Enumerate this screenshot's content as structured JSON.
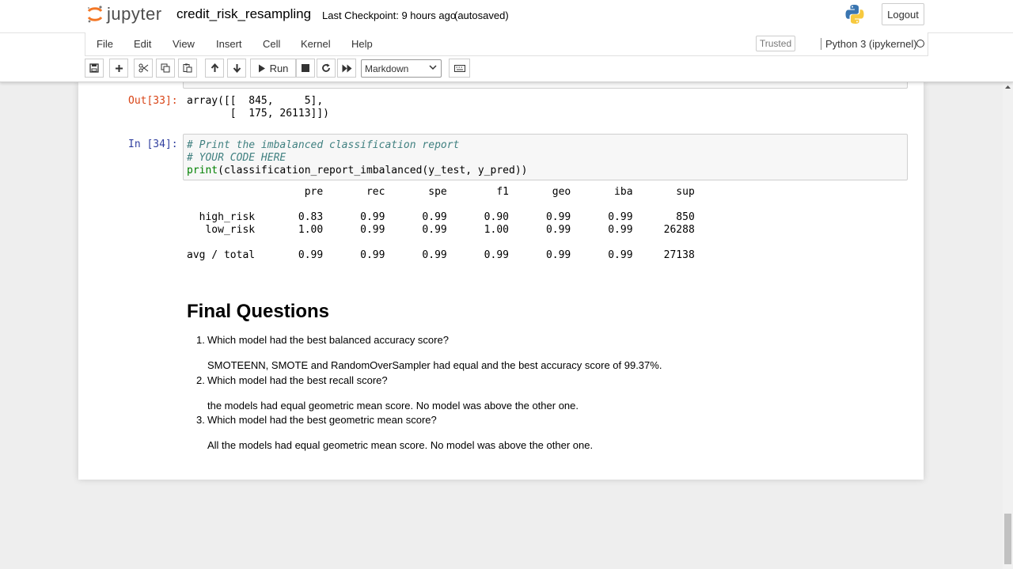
{
  "header": {
    "logo_text": "jupyter",
    "notebook_name": "credit_risk_resampling",
    "checkpoint": "Last Checkpoint: 9 hours ago",
    "autosave": "(autosaved)",
    "logout_label": "Logout"
  },
  "menu": {
    "items": [
      "File",
      "Edit",
      "View",
      "Insert",
      "Cell",
      "Kernel",
      "Help"
    ],
    "trusted": "Trusted",
    "kernel": "Python 3 (ipykernel)"
  },
  "toolbar": {
    "run_label": "Run",
    "cell_type": "Markdown",
    "icons": [
      "save-icon",
      "plus-icon",
      "scissors-icon",
      "copy-icon",
      "paste-icon",
      "arrow-up-icon",
      "arrow-down-icon",
      "run-icon",
      "stop-icon",
      "restart-icon",
      "fast-forward-icon",
      "keyboard-icon"
    ]
  },
  "cells": {
    "out33_prompt": "Out[33]:",
    "out33_lines": [
      "array([[  845,     5],",
      "       [  175, 26113]])"
    ],
    "in34_prompt": "In [34]:",
    "in34_code": [
      "# Print the imbalanced classification report",
      "# YOUR CODE HERE",
      "print(classification_report_imbalanced(y_test, y_pred))"
    ],
    "report_lines": [
      "                   pre       rec       spe        f1       geo       iba       sup",
      "",
      "  high_risk       0.83      0.99      0.99      0.90      0.99      0.99       850",
      "   low_risk       1.00      0.99      0.99      1.00      0.99      0.99     26288",
      "",
      "avg / total       0.99      0.99      0.99      0.99      0.99      0.99     27138"
    ]
  },
  "markdown": {
    "heading": "Final Questions",
    "questions": [
      {
        "number": "1.",
        "q": "Which model had the best balanced accuracy score?",
        "a": "SMOTEENN, SMOTE and RandomOverSampler had equal and the best accuracy score of 99.37%."
      },
      {
        "number": "2.",
        "q": "Which model had the best recall score?",
        "a": "the models had equal geometric mean score. No model was above the other one."
      },
      {
        "number": "3.",
        "q": "Which model had the best geometric mean score?",
        "a": "All the models had equal geometric mean score. No model was above the other one."
      }
    ]
  },
  "colors": {
    "in_prompt": "#303f9f",
    "out_prompt": "#d84315",
    "comment": "#408080",
    "builtin": "#008000"
  }
}
